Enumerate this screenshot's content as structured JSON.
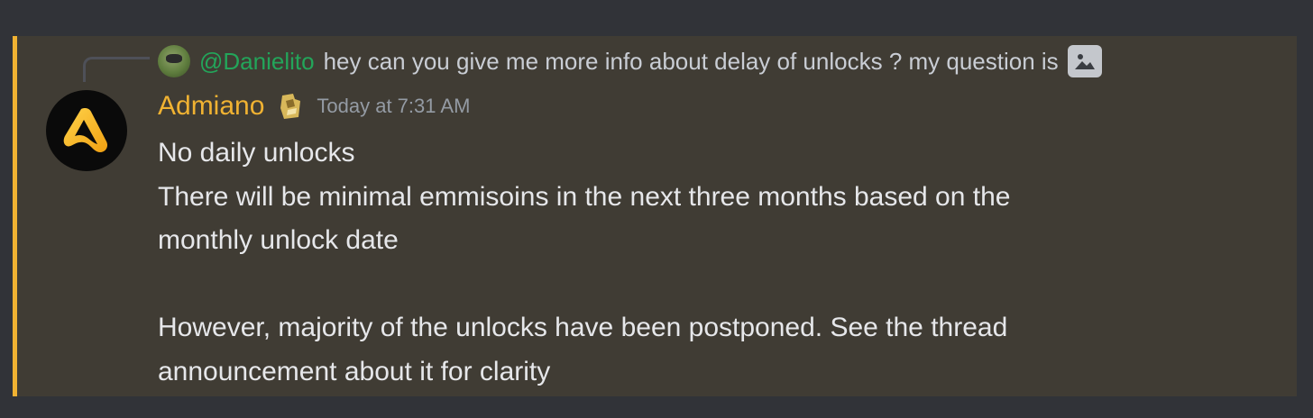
{
  "reply": {
    "mention": "@Danielito",
    "text": "hey can you give me more info about delay of unlocks ? my question is",
    "attachment_icon": "image-icon"
  },
  "message": {
    "username": "Admiano",
    "role_icon": "badge-icon",
    "timestamp": "Today at 7:31 AM",
    "lines": [
      "No daily unlocks",
      "There will be minimal emmisoins in the next three months based on the",
      "monthly unlock date",
      "",
      "However, majority of the unlocks have been postponed. See the thread",
      "announcement about it for clarity"
    ]
  },
  "colors": {
    "background": "#313338",
    "highlight_bg": "#403c34",
    "highlight_bar": "#f0b232",
    "username": "#f0b232",
    "mention": "#23a55a",
    "text": "#e6e7ea",
    "muted": "#949ba4"
  }
}
